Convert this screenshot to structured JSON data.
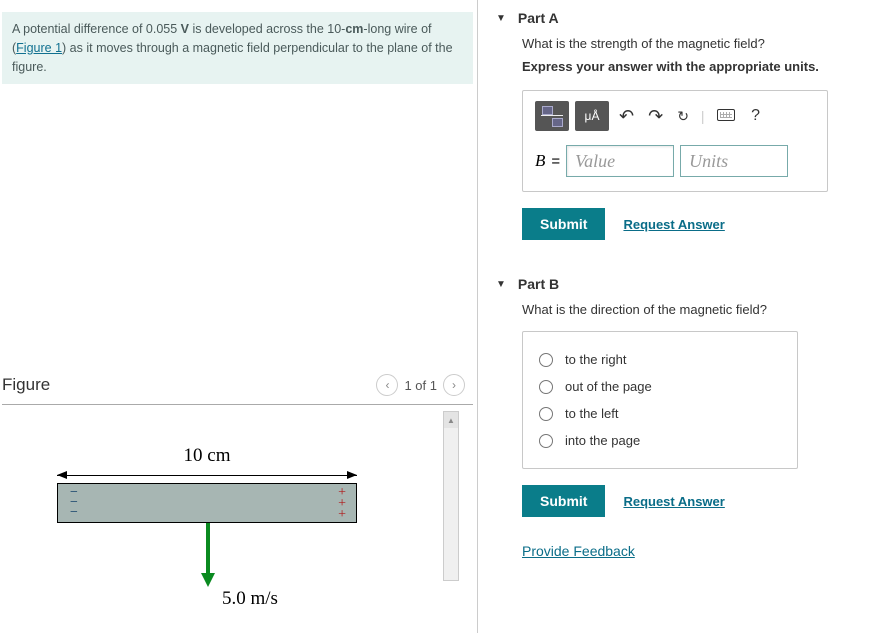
{
  "problem": {
    "prefix": "A potential difference of 0.055 ",
    "unitV": "V",
    "mid1": " is developed across the 10-",
    "unitCm": "cm",
    "mid2": "-long wire of (",
    "figlink": "Figure 1",
    "suffix": ") as it moves through a magnetic field perpendicular to the plane of the figure."
  },
  "figure": {
    "title": "Figure",
    "nav": "1 of 1",
    "length_label": "10 cm",
    "velocity_label": "5.0 m/s"
  },
  "partA": {
    "title": "Part A",
    "question": "What is the strength of the magnetic field?",
    "instruction": "Express your answer with the appropriate units.",
    "mu_label": "μÅ",
    "var": "B",
    "eq": "=",
    "value_ph": "Value",
    "units_ph": "Units",
    "submit": "Submit",
    "request": "Request Answer",
    "help": "?"
  },
  "partB": {
    "title": "Part B",
    "question": "What is the direction of the magnetic field?",
    "options": [
      "to the right",
      "out of the page",
      "to the left",
      "into the page"
    ],
    "submit": "Submit",
    "request": "Request Answer"
  },
  "feedback": "Provide Feedback"
}
